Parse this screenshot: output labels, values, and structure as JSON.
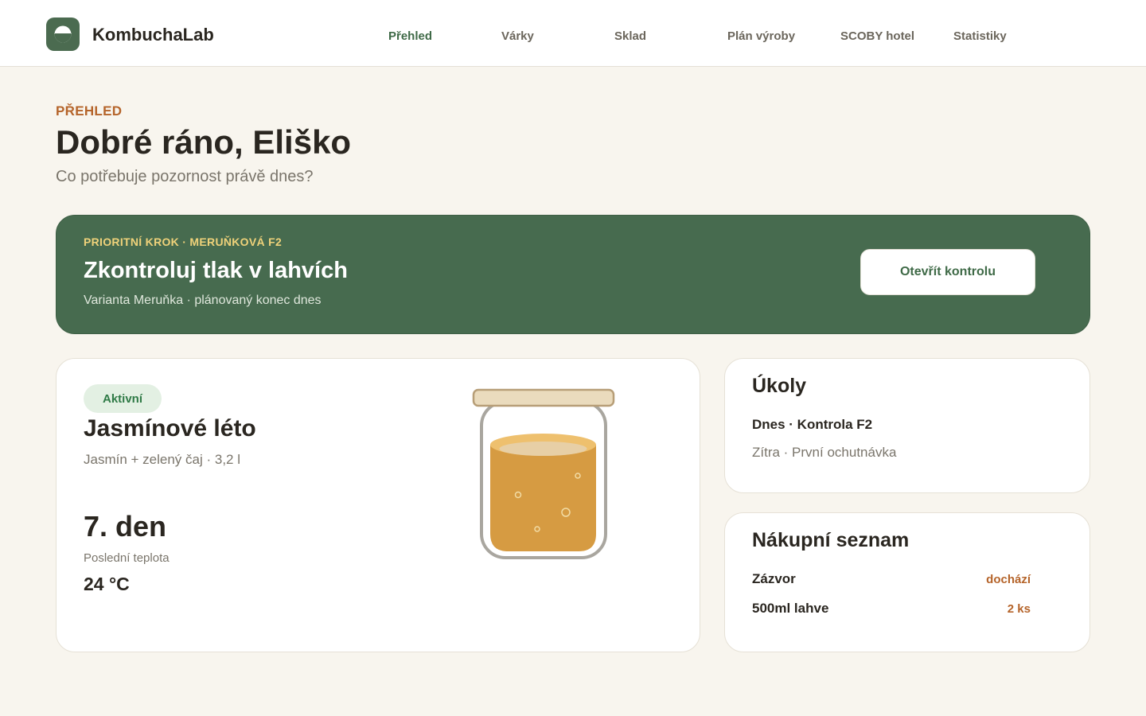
{
  "app": {
    "name": "KombuchaLab"
  },
  "nav": {
    "items": [
      {
        "label": "Přehled",
        "active": true
      },
      {
        "label": "Várky",
        "active": false
      },
      {
        "label": "Sklad",
        "active": false
      },
      {
        "label": "Plán výroby",
        "active": false
      },
      {
        "label": "SCOBY hotel",
        "active": false
      },
      {
        "label": "Statistiky",
        "active": false
      }
    ]
  },
  "intro": {
    "eyebrow": "PŘEHLED",
    "greeting": "Dobré ráno, Eliško",
    "subtitle": "Co potřebuje pozornost právě dnes?"
  },
  "priority": {
    "kicker": "PRIORITNÍ KROK · MERUŇKOVÁ F2",
    "title": "Zkontroluj tlak v lahvích",
    "meta": "Varianta Meruňka · plánovaný konec dnes",
    "button_label": "Otevřít kontrolu"
  },
  "batch": {
    "status": "Aktivní",
    "name": "Jasmínové léto",
    "description": "Jasmín + zelený čaj · 3,2 l",
    "day": "7. den",
    "temp_label": "Poslední teplota",
    "temp_value": "24 °C",
    "icon": "kombucha-jar-icon"
  },
  "tasks": {
    "title": "Úkoly",
    "items": [
      {
        "label": "Dnes · Kontrola F2"
      },
      {
        "label": "Zítra · První ochutnávka"
      }
    ]
  },
  "shopping": {
    "title": "Nákupní seznam",
    "items": [
      {
        "name": "Zázvor",
        "status": "dochází"
      },
      {
        "name": "500ml lahve",
        "status": "2 ks"
      }
    ]
  },
  "colors": {
    "brand_green": "#476b4f",
    "accent_orange": "#b5642a",
    "kicker_yellow": "#efd27a",
    "background": "#f8f5ee"
  }
}
